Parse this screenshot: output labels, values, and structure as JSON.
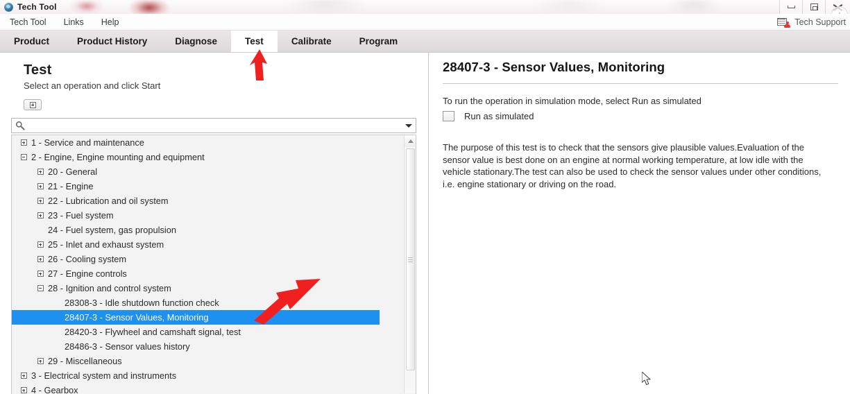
{
  "window": {
    "title": "Tech Tool",
    "app_icon": "app-globe-icon",
    "controls": {
      "minimize": "minimize-icon",
      "restore": "restore-icon",
      "close": "close-icon",
      "help": "i"
    }
  },
  "menubar": {
    "items": [
      {
        "label": "Tech Tool"
      },
      {
        "label": "Links"
      },
      {
        "label": "Help"
      }
    ],
    "support": {
      "icon": "tech-support-contact-icon",
      "label": "Tech Support"
    }
  },
  "navtabs": [
    {
      "label": "Product",
      "active": false
    },
    {
      "label": "Product History",
      "active": false
    },
    {
      "label": "Diagnose",
      "active": false
    },
    {
      "label": "Test",
      "active": true
    },
    {
      "label": "Calibrate",
      "active": false
    },
    {
      "label": "Program",
      "active": false
    }
  ],
  "left_pane": {
    "title": "Test",
    "subtitle": "Select an operation and click Start",
    "expand_all_button": "expand-all-icon",
    "search": {
      "value": "",
      "placeholder": "",
      "icon": "search-icon",
      "dropdown_icon": "chevron-down-icon"
    },
    "tree": [
      {
        "indent": 0,
        "toggle": "plus",
        "label": "1 - Service and maintenance",
        "selected": false
      },
      {
        "indent": 0,
        "toggle": "minus",
        "label": "2 - Engine, Engine mounting and equipment",
        "selected": false
      },
      {
        "indent": 1,
        "toggle": "plus",
        "label": "20 - General",
        "selected": false
      },
      {
        "indent": 1,
        "toggle": "plus",
        "label": "21 - Engine",
        "selected": false
      },
      {
        "indent": 1,
        "toggle": "plus",
        "label": "22 - Lubrication and oil system",
        "selected": false
      },
      {
        "indent": 1,
        "toggle": "plus",
        "label": "23 - Fuel system",
        "selected": false
      },
      {
        "indent": 1,
        "toggle": "none",
        "label": "24 - Fuel system, gas propulsion",
        "selected": false
      },
      {
        "indent": 1,
        "toggle": "plus",
        "label": "25 - Inlet and exhaust system",
        "selected": false
      },
      {
        "indent": 1,
        "toggle": "plus",
        "label": "26 - Cooling system",
        "selected": false
      },
      {
        "indent": 1,
        "toggle": "plus",
        "label": "27 - Engine controls",
        "selected": false
      },
      {
        "indent": 1,
        "toggle": "minus",
        "label": "28 - Ignition and control system",
        "selected": false
      },
      {
        "indent": 2,
        "toggle": "none",
        "label": "28308-3 - Idle shutdown function check",
        "selected": false
      },
      {
        "indent": 2,
        "toggle": "none",
        "label": "28407-3 - Sensor Values, Monitoring",
        "selected": true
      },
      {
        "indent": 2,
        "toggle": "none",
        "label": "28420-3 - Flywheel and camshaft signal, test",
        "selected": false
      },
      {
        "indent": 2,
        "toggle": "none",
        "label": "28486-3 - Sensor values history",
        "selected": false
      },
      {
        "indent": 1,
        "toggle": "plus",
        "label": "29 - Miscellaneous",
        "selected": false
      },
      {
        "indent": 0,
        "toggle": "plus",
        "label": "3 - Electrical system and instruments",
        "selected": false
      },
      {
        "indent": 0,
        "toggle": "plus",
        "label": "4 - Gearbox",
        "selected": false
      }
    ]
  },
  "right_pane": {
    "title": "28407-3 - Sensor Values, Monitoring",
    "instruction": "To run the operation in simulation mode, select Run as simulated",
    "checkbox": {
      "label": "Run as simulated",
      "checked": false
    },
    "description": "The purpose of this test is to check that the sensors give plausible values.Evaluation of the sensor value is best done on an engine at normal working temperature, at low idle with the vehicle stationary.The test can also be used to check the sensor values under other conditions, i.e. engine stationary or driving on the road."
  },
  "annotations": {
    "tab_arrow": {
      "color": "#f02020",
      "points_to": "Test"
    },
    "tree_arrow": {
      "color": "#f02020",
      "points_to": "28407-3 - Sensor Values, Monitoring"
    }
  },
  "colors": {
    "selection_blue": "#1e90ef",
    "annotation_red": "#f02020",
    "nav_bg": "#e4dfe0",
    "tree_bg": "#f3f3f3"
  }
}
